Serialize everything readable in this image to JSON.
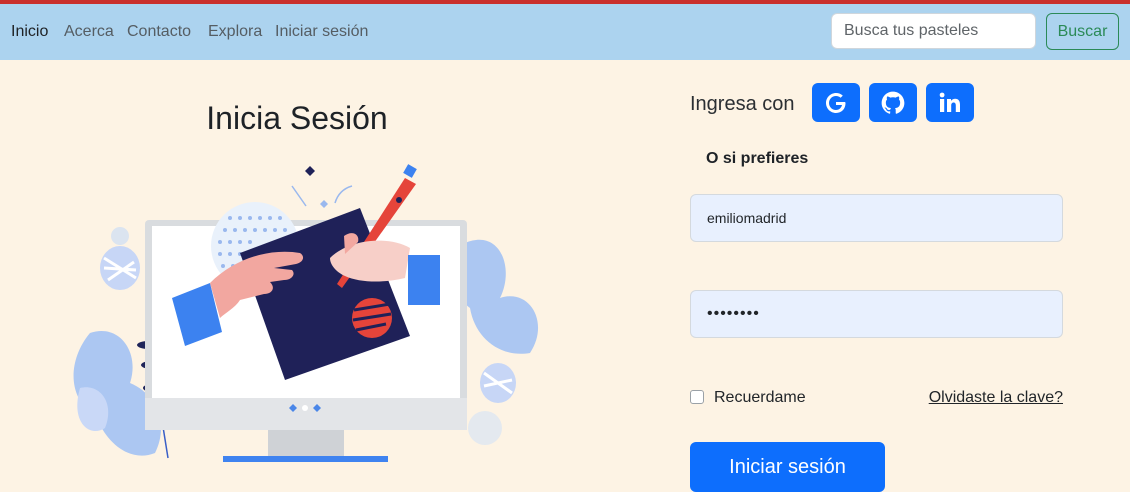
{
  "nav": {
    "items": [
      "Inicio",
      "Acerca",
      "Contacto",
      "Explora",
      "Iniciar sesión"
    ],
    "search_placeholder": "Busca tus pasteles",
    "search_button": "Buscar"
  },
  "login": {
    "title": "Inicia Sesión",
    "social_label": "Ingresa con",
    "social_icons": [
      "google-icon",
      "github-icon",
      "linkedin-icon"
    ],
    "alt_label": "O si prefieres",
    "username_value": "emiliomadrid",
    "password_value": "••••••••",
    "remember_label": "Recuerdame",
    "remember_checked": false,
    "forgot_label": "Olvidaste la clave?",
    "submit_label": "Iniciar sesión"
  },
  "colors": {
    "navbar": "#acd3ef",
    "background": "#fdf3e4",
    "primary": "#0d6efd",
    "search_button": "#2b8a57",
    "top_line": "#c9302c"
  }
}
